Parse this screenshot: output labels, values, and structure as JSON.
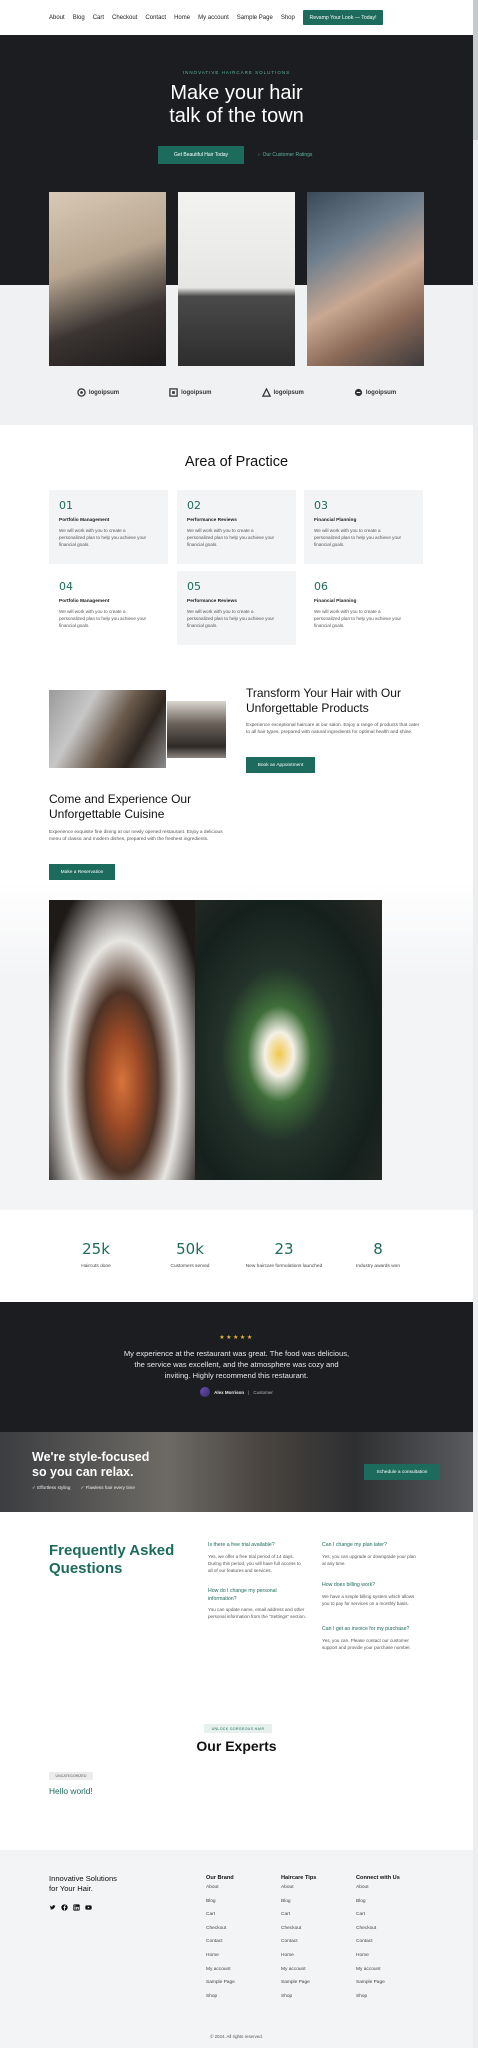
{
  "nav": {
    "links": [
      "About",
      "Blog",
      "Cart",
      "Checkout",
      "Contact",
      "Home",
      "My account",
      "Sample Page",
      "Shop"
    ],
    "cta": "Revamp Your Look — Today!"
  },
  "hero": {
    "eyebrow": "INNOVATIVE HAIRCARE SOLUTIONS",
    "title_line1": "Make your hair",
    "title_line2": "talk of the town",
    "primary_button": "Get Beautiful Hair Today",
    "secondary_link": "Our Customer Ratings",
    "secondary_icon": "chevron-right-icon"
  },
  "logos": [
    "logoipsum",
    "logoipsum",
    "logoipsum",
    "logoipsum"
  ],
  "practice": {
    "title": "Area of Practice",
    "cards": [
      {
        "num": "01",
        "title": "Portfolio Management",
        "desc": "We will work with you to create a personalized plan to help you achieve your financial goals."
      },
      {
        "num": "02",
        "title": "Performance Reviews",
        "desc": "We will work with you to create a personalized plan to help you achieve your financial goals."
      },
      {
        "num": "03",
        "title": "Financial Planning",
        "desc": "We will work with you to create a personalized plan to help you achieve your financial goals."
      },
      {
        "num": "04",
        "title": "Portfolio Management",
        "desc": "We will work with you to create a personalized plan to help you achieve your financial goals."
      },
      {
        "num": "05",
        "title": "Performance Reviews",
        "desc": "We will work with you to create a personalized plan to help you achieve your financial goals."
      },
      {
        "num": "06",
        "title": "Financial Planning",
        "desc": "We will work with you to create a personalized plan to help you achieve your financial goals."
      }
    ]
  },
  "products": {
    "title": "Transform Your Hair with Our Unforgettable Products",
    "desc": "Experience exceptional haircare at our salon. Enjoy a range of products that cater to all hair types, prepared with natural ingredients for optimal health and shine.",
    "button": "Book an Appointment"
  },
  "cuisine": {
    "title": "Come and Experience Our Unforgettable Cuisine",
    "desc": "Experience exquisite fine dining at our newly opened restaurant. Enjoy a delicious menu of classic and modern dishes, prepared with the freshest ingredients.",
    "button": "Make a Reservation"
  },
  "stats": [
    {
      "value": "25k",
      "label": "Haircuts done"
    },
    {
      "value": "50k",
      "label": "Customers served"
    },
    {
      "value": "23",
      "label": "New haircare formulations launched"
    },
    {
      "value": "8",
      "label": "Industry awards won"
    }
  ],
  "testimonial": {
    "stars": "★★★★★",
    "quote": "My experience at the restaurant was great. The food was delicious, the service was excellent, and the atmosphere was cozy and inviting. Highly recommend this restaurant.",
    "author": "Alex Morrison",
    "role": "Customer"
  },
  "relax": {
    "title_line1": "We're style-focused",
    "title_line2": "so you can relax.",
    "check1": "✓ Effortless styling",
    "check2": "✓ Flawless hair every time",
    "button": "Schedule a consultation"
  },
  "faq": {
    "title": "Frequently Asked Questions",
    "items": [
      {
        "q": "Is there a free trial available?",
        "a": "Yes, we offer a free trial period of 14 days. During this period, you will have full access to all of our features and services."
      },
      {
        "q": "How do I change my personal information?",
        "a": "You can update name, email address and other personal information from the \"Settings\" section."
      },
      {
        "q": "Can I change my plan later?",
        "a": "Yes, you can upgrade or downgrade your plan at any time."
      },
      {
        "q": "How does billing work?",
        "a": "We have a simple billing system which allows you to pay for services on a monthly basis."
      },
      {
        "q": "Can I get an invoice for my purchase?",
        "a": "Yes, you can. Please contact our customer support and provide your purchase number."
      }
    ]
  },
  "experts": {
    "tag": "UNLOCK GORGEOUS HAIR",
    "title": "Our Experts",
    "post_category": "UNCATEGORIZED",
    "post_title": "Hello world!"
  },
  "footer": {
    "brand_line1": "Innovative Solutions",
    "brand_line2": "for Your Hair.",
    "socials": [
      "twitter-icon",
      "facebook-icon",
      "linkedin-icon",
      "youtube-icon"
    ],
    "columns": [
      {
        "heading": "Our Brand",
        "links": [
          "About",
          "Blog",
          "Cart",
          "Checkout",
          "Contact",
          "Home",
          "My account",
          "Sample Page",
          "Shop"
        ]
      },
      {
        "heading": "Haircare Tips",
        "links": [
          "About",
          "Blog",
          "Cart",
          "Checkout",
          "Contact",
          "Home",
          "My account",
          "Sample Page",
          "Shop"
        ]
      },
      {
        "heading": "Connect with Us",
        "links": [
          "About",
          "Blog",
          "Cart",
          "Checkout",
          "Contact",
          "Home",
          "My account",
          "Sample Page",
          "Shop"
        ]
      }
    ],
    "copyright": "© 2024. All rights reserved."
  },
  "colors": {
    "accent": "#1d6b5c",
    "dark": "#1b1d20",
    "light": "#f3f4f6",
    "star": "#e6b93a"
  }
}
